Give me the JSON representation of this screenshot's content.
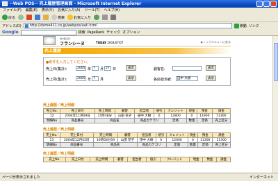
{
  "browser": {
    "title": "--Web POS-- 売上履歴管理画面 - Microsoft Internet Explorer",
    "menu": [
      "ファイル(F)",
      "編集(E)",
      "表示(V)",
      "お気に入り(A)",
      "ツール(T)",
      "ヘルプ(H)"
    ],
    "toolbar": {
      "back": "戻る",
      "search": "検索",
      "favorites": "お気に入り"
    },
    "address_label": "アドレス(D)",
    "address": "http://demo411.co.jp/webpos/ueli.html",
    "go": "移動",
    "links_label": "リンク",
    "google": {
      "logo": "Google",
      "search_btn": "検索",
      "pagerank": "PageRank",
      "check": "チェック",
      "options": "オプション"
    },
    "status": {
      "text": "ページが表示されました",
      "zone": "インターネット"
    }
  },
  "page": {
    "brand_small": "webpos",
    "brand": "フランシーヌ",
    "today_label": "TODAY",
    "today": "2004/07/07",
    "top_link": "▶トップメニューに戻る",
    "title": "売上履歴",
    "form": {
      "note": "●条件を入力してください。",
      "date_label": "売上日(集計):",
      "date_year": "2005",
      "date_month": "7",
      "date_day": "27",
      "year_unit": "年",
      "month_unit": "月",
      "day_unit": "日",
      "display1": "表示",
      "customer_label": "顧客名:",
      "display2": "表示",
      "month_label": "売上月(集計):",
      "month_year": "2005",
      "month_month": "7",
      "display3": "表示",
      "staff_label": "各店担当者:",
      "staff_value": "田中 大樹",
      "display4": "表示"
    },
    "sections": [
      {
        "title": "売上履歴／売上明細",
        "headers": [
          "売上No.",
          "売上日付",
          "売上時間",
          "顧客",
          "担当者",
          "値引",
          "クレジット",
          "現金",
          "預金",
          "請金"
        ],
        "row": [
          "12",
          "2004年11月09日",
          "11時38分",
          "山田 花子",
          "田中 大樹",
          "0",
          "12800",
          "0",
          "11900",
          "11300"
        ],
        "headers2": [
          "明細No",
          "商品番号",
          "商品名",
          "商品カテゴリ",
          "定価",
          "数量",
          "定価",
          "売上区分"
        ]
      },
      {
        "title": "売上履歴／売上明細",
        "headers": [
          "売上No.",
          "売上日付",
          "売上時間",
          "顧客",
          "担当者",
          "値引",
          "クレジット",
          "現金",
          "預金",
          "請金"
        ],
        "row": [
          "13",
          "2004年12月02日",
          "16時58分59",
          "山田 花子",
          "田中 大樹",
          "0",
          "12000",
          "0",
          "11300",
          "11300"
        ],
        "headers2": [
          "明細No",
          "商品番号",
          "商品名",
          "商品カテゴリ",
          "定価",
          "数量",
          "定価",
          "売上区分"
        ]
      },
      {
        "title": "売上履歴／売上明細",
        "headers": [
          "売上No.",
          "売上日付",
          "売上時間",
          "顧客",
          "担当者",
          "値引",
          "クレジット",
          "現金",
          "預金",
          "請金"
        ]
      }
    ]
  }
}
